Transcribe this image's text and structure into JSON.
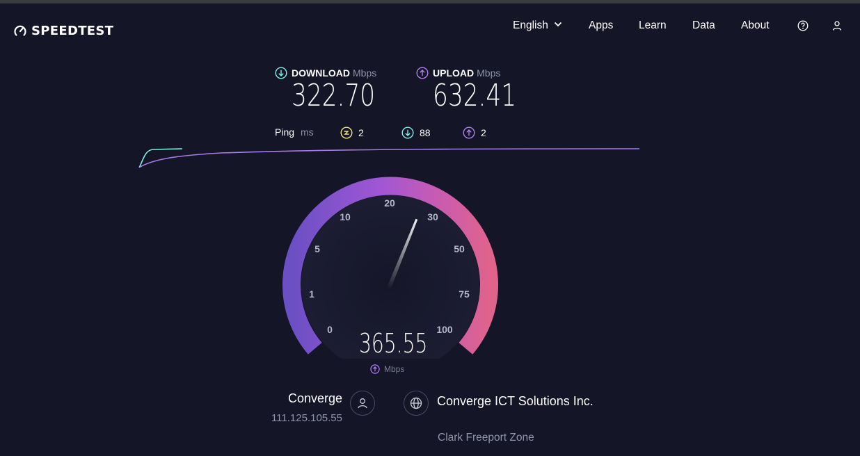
{
  "header": {
    "logo_text": "SPEEDTEST",
    "nav": {
      "language": "English",
      "apps": "Apps",
      "learn": "Learn",
      "data": "Data",
      "about": "About"
    },
    "icons": [
      "speedometer-icon",
      "chevron-down-icon",
      "help-icon",
      "user-icon"
    ]
  },
  "results": {
    "download": {
      "label": "DOWNLOAD",
      "unit": "Mbps",
      "value": "322.70"
    },
    "upload": {
      "label": "UPLOAD",
      "unit": "Mbps",
      "value": "632.41"
    },
    "ping": {
      "label": "Ping",
      "unit": "ms",
      "idle": "2",
      "download": "88",
      "upload": "2"
    }
  },
  "gauge": {
    "ticks": [
      "0",
      "1",
      "5",
      "10",
      "20",
      "30",
      "50",
      "75",
      "100"
    ],
    "value": "365.55",
    "unit": "Mbps",
    "needle_value": 30
  },
  "connection": {
    "isp_name": "Converge",
    "ip": "111.125.105.55",
    "server_name": "Converge ICT Solutions Inc.",
    "server_location": "Clark Freeport Zone"
  },
  "colors": {
    "background": "#141526",
    "download_accent": "#7ef0e6",
    "upload_accent": "#b17ff0",
    "ping_idle": "#f2e58a",
    "gauge_start": "#6b4fc4",
    "gauge_end": "#e0638c"
  }
}
